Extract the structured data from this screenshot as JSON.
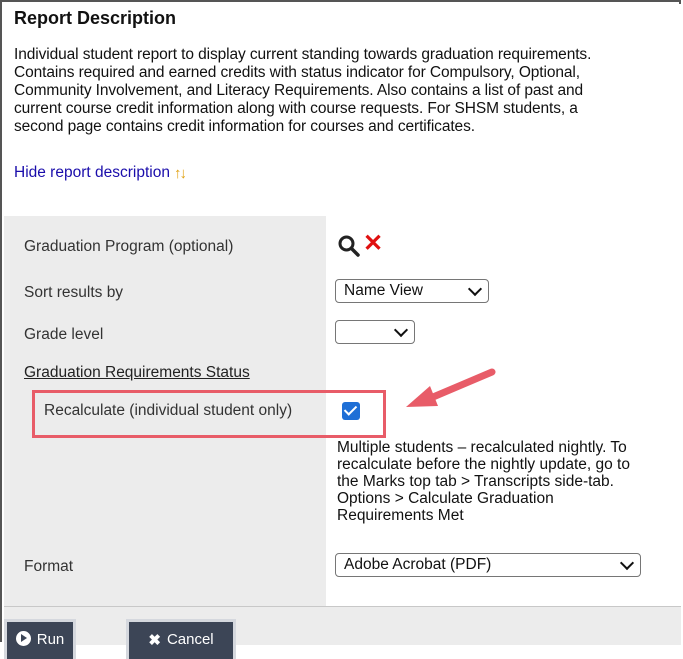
{
  "description": {
    "title": "Report Description",
    "lines": [
      "Individual student report to display current standing towards graduation requirements.",
      "Contains required and earned credits with status indicator for Compulsory, Optional,",
      "Community Involvement, and Literacy Requirements. Also contains a list of past and",
      "current course credit information along with course requests. For SHSM students, a",
      "second page contains credit information for courses and certificates."
    ],
    "hide_link": "Hide report description",
    "hide_icon": "sort-arrows-icon"
  },
  "params": {
    "graduation_program_label": "Graduation Program (optional)",
    "sort_label": "Sort results by",
    "sort_value": "Name View",
    "grade_label": "Grade level",
    "grade_value": "",
    "status_label": "Graduation Requirements Status",
    "recalc_label": "Recalculate (individual student only)",
    "recalc_checked": true,
    "help_lines": [
      "Multiple students – recalculated nightly. To",
      "recalculate before the nightly update, go to",
      "the Marks top tab > Transcripts side-tab.",
      "Options > Calculate Graduation",
      "Requirements Met"
    ],
    "format_label": "Format",
    "format_value": "Adobe Acrobat (PDF)"
  },
  "footer": {
    "run_label": "Run",
    "cancel_label": "Cancel"
  },
  "colors": {
    "annotation": "#e85c68",
    "button_bg": "#3c4556",
    "checkbox": "#1f6fd6",
    "clear_icon": "#e01010"
  }
}
